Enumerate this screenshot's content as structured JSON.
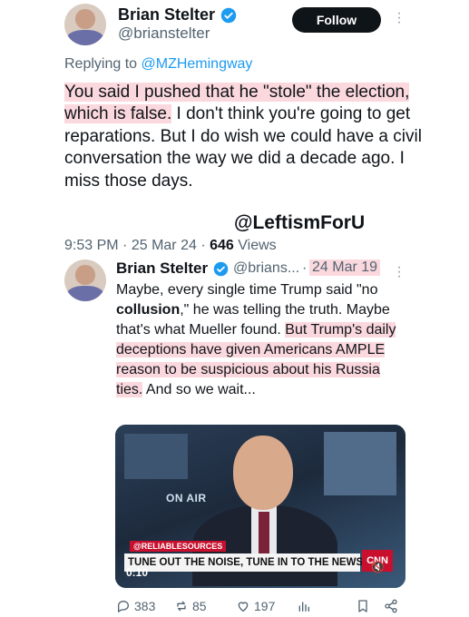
{
  "author": {
    "name": "Brian Stelter",
    "handle": "@brianstelter"
  },
  "follow_label": "Follow",
  "replying": {
    "prefix": "Replying to",
    "mention": "@MZHemingway"
  },
  "tweet": {
    "highlight": "You said I pushed that he \"stole\" the election, which is false.",
    "rest": " I don't think you're going to get reparations. But I do wish we could have a civil conversation the way we did a decade ago. I miss those days."
  },
  "watermark": "@LeftismForU",
  "meta": {
    "time": "9:53 PM",
    "date": "25 Mar 24",
    "views_count": "646",
    "views_label": "Views"
  },
  "quote": {
    "name": "Brian Stelter",
    "handle": "@brians...",
    "date": "24 Mar 19",
    "text_a": "Maybe, every single time Trump said \"no ",
    "text_bold": "collusion",
    "text_b": ",\" he was telling the truth. Maybe that's what Mueller found. ",
    "text_hl": "But Trump's daily deceptions have given Americans AMPLE reason to be suspicious about his Russia ties.",
    "text_c": " And so we wait..."
  },
  "video": {
    "on_air": "ON AIR",
    "tag": "@RELIABLESOURCES",
    "banner": "TUNE OUT THE NOISE, TUNE IN TO THE NEWS",
    "network": "CNN",
    "timer": "0:10"
  },
  "actions": {
    "replies": "383",
    "reposts": "85",
    "likes": "197"
  },
  "colors": {
    "accent": "#1d9bf0",
    "highlight": "#fbd8dd"
  }
}
